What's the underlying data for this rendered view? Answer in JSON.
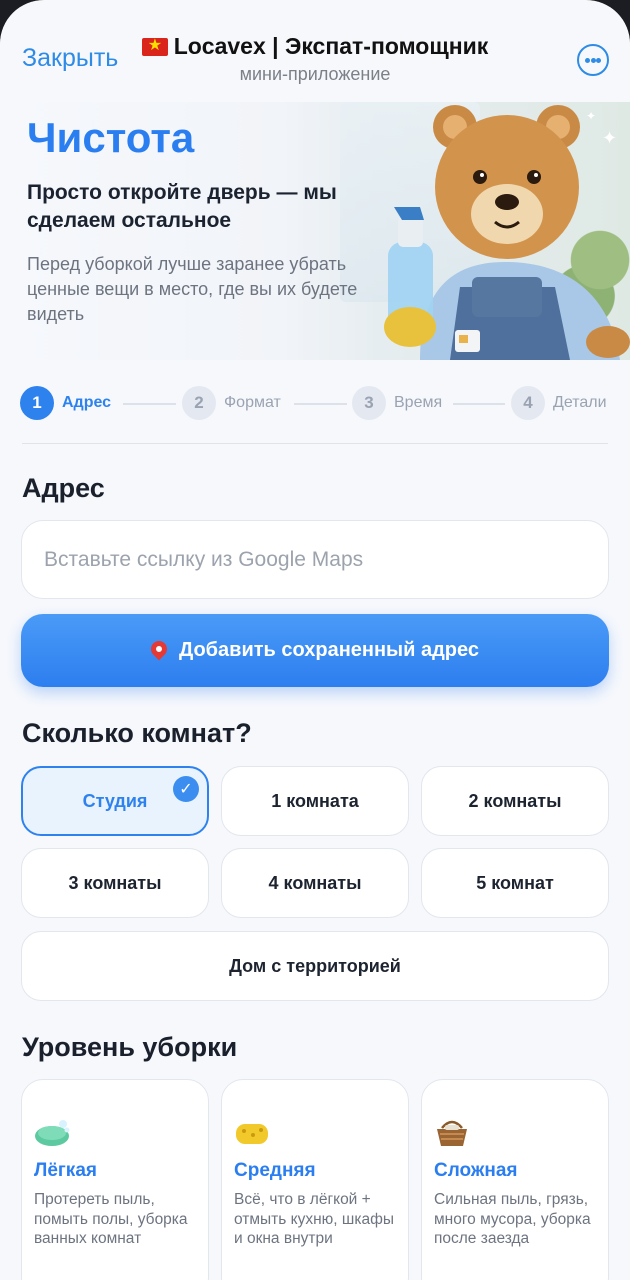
{
  "header": {
    "close_label": "Закрыть",
    "title": "Locavex | Экспат-помощник",
    "subtitle": "мини-приложение",
    "more_icon": "ellipsis-circle-icon"
  },
  "hero": {
    "title": "Чистота",
    "lead": "Просто откройте дверь — мы сделаем остальное",
    "note": "Перед уборкой лучше заранее убрать ценные вещи в место, где вы их будете видеть"
  },
  "steps": [
    {
      "num": "1",
      "label": "Адрес",
      "active": true
    },
    {
      "num": "2",
      "label": "Формат",
      "active": false
    },
    {
      "num": "3",
      "label": "Время",
      "active": false
    },
    {
      "num": "4",
      "label": "Детали",
      "active": false
    }
  ],
  "address": {
    "heading": "Адрес",
    "placeholder": "Вставьте ссылку из Google Maps",
    "value": "",
    "add_saved_label": "Добавить сохраненный адрес"
  },
  "rooms": {
    "heading": "Сколько комнат?",
    "options": [
      "Студия",
      "1 комната",
      "2 комнаты",
      "3 комнаты",
      "4 комнаты",
      "5 комнат",
      "Дом с территорией"
    ],
    "selected": "Студия"
  },
  "levels": {
    "heading": "Уровень уборки",
    "items": [
      {
        "icon": "soap-icon",
        "title": "Лёгкая",
        "desc": "Протереть пыль, помыть полы, уборка ванных комнат"
      },
      {
        "icon": "sponge-icon",
        "title": "Средняя",
        "desc": "Всё, что в лёгкой + отмыть кухню, шкафы и окна внутри"
      },
      {
        "icon": "basket-icon",
        "title": "Сложная",
        "desc": "Сильная пыль, грязь, много мусора, уборка после заезда"
      }
    ]
  },
  "colors": {
    "accent": "#2e82ee",
    "selected_bg": "#e9f3fe",
    "hero_title": "#2a7ef0"
  }
}
